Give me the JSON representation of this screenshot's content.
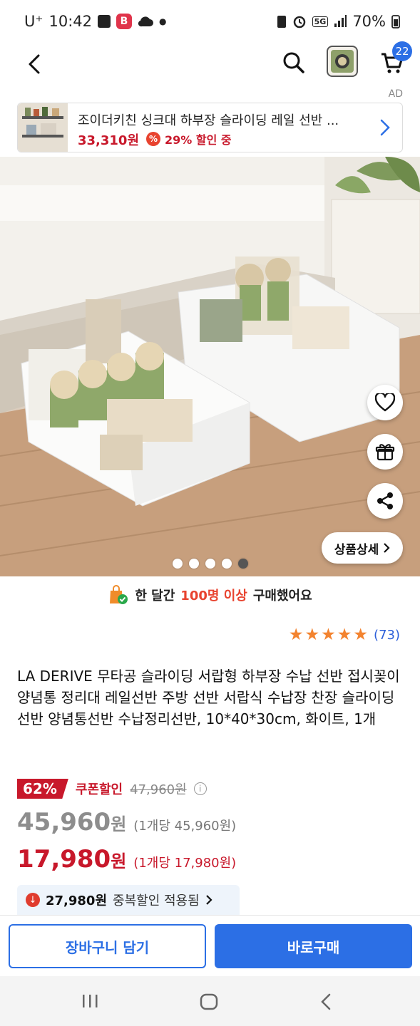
{
  "status_bar": {
    "carrier": "U⁺",
    "time": "10:42",
    "battery": "70%",
    "network": "5G"
  },
  "header": {
    "cart_count": "22",
    "icons": [
      "back-arrow-icon",
      "search-icon",
      "cart-icon"
    ]
  },
  "ad": {
    "label": "AD",
    "title": "조이더키친 싱크대 하부장 슬라이딩 레일 선반 ...",
    "price": "33,310원",
    "discount": "29% 할인 중",
    "pct_symbol": "%"
  },
  "gallery": {
    "total": 5,
    "active_index": 4,
    "detail_button": "상품상세"
  },
  "notice": {
    "prefix": "한 달간",
    "highlight": "100명 이상",
    "suffix": "구매했어요"
  },
  "rating": {
    "stars": 5,
    "count": "(73)"
  },
  "product": {
    "title": "LA DERIVE 무타공 슬라이딩 서랍형 하부장 수납 선반 접시꽂이 양념통 정리대 레일선반 주방 선반 서랍식 수납장 찬장 슬라이딩선반 양념통선반 수납정리선반, 10*40*30cm, 화이트, 1개"
  },
  "pricing": {
    "discount_pct": "62%",
    "coupon_label": "쿠폰할인",
    "original_price": "47,960원",
    "price1_value": "45,960",
    "price1_won": "원",
    "price1_unit": "(1개당 45,960원)",
    "price2_value": "17,980",
    "price2_won": "원",
    "price2_unit": "(1개당 17,980원)",
    "dup_amount": "27,980원",
    "dup_label": "중복할인 적용됨"
  },
  "actions": {
    "cart_button": "장바구니 담기",
    "buy_button": "바로구매"
  },
  "colors": {
    "accent_blue": "#2c6fe5",
    "price_red": "#c8182b",
    "star_orange": "#f3832f"
  }
}
